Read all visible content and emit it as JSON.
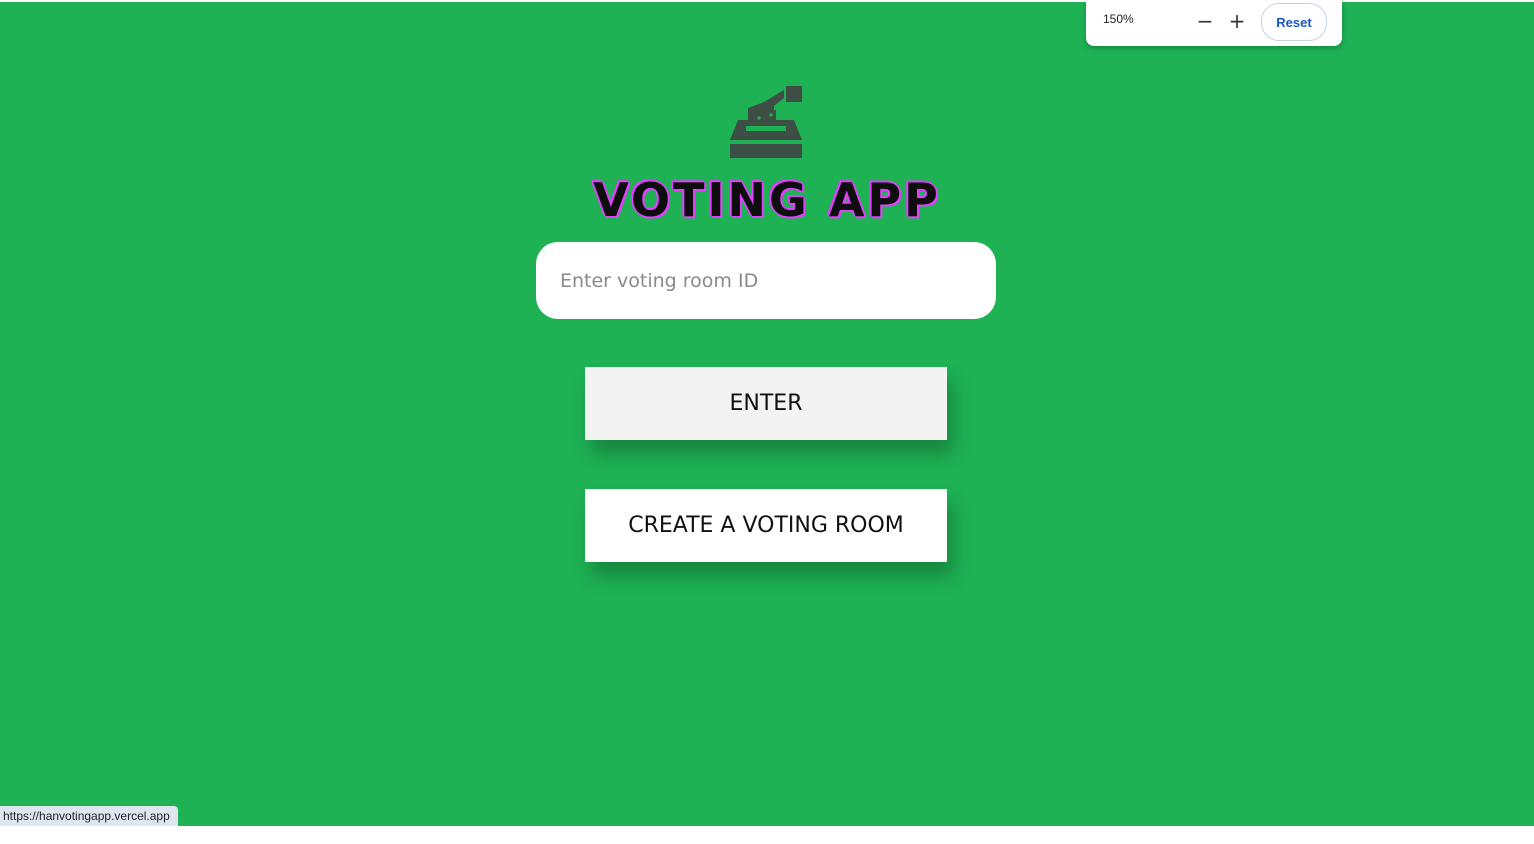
{
  "app": {
    "title": "VOTING APP",
    "logo_icon": "ballot-box-icon"
  },
  "form": {
    "room_id_placeholder": "Enter voting room ID",
    "room_id_value": "",
    "enter_label": "ENTER",
    "create_label": "CREATE A VOTING ROOM"
  },
  "zoom": {
    "level": "150%",
    "zoom_out_icon": "minus-icon",
    "zoom_in_icon": "plus-icon",
    "reset_label": "Reset"
  },
  "status_bar": {
    "url": "https://hanvotingapp.vercel.app"
  },
  "colors": {
    "background": "#1eb254",
    "title_outline": "#e040fb",
    "logo": "#3d4f45",
    "reset_text": "#1a56c4"
  }
}
